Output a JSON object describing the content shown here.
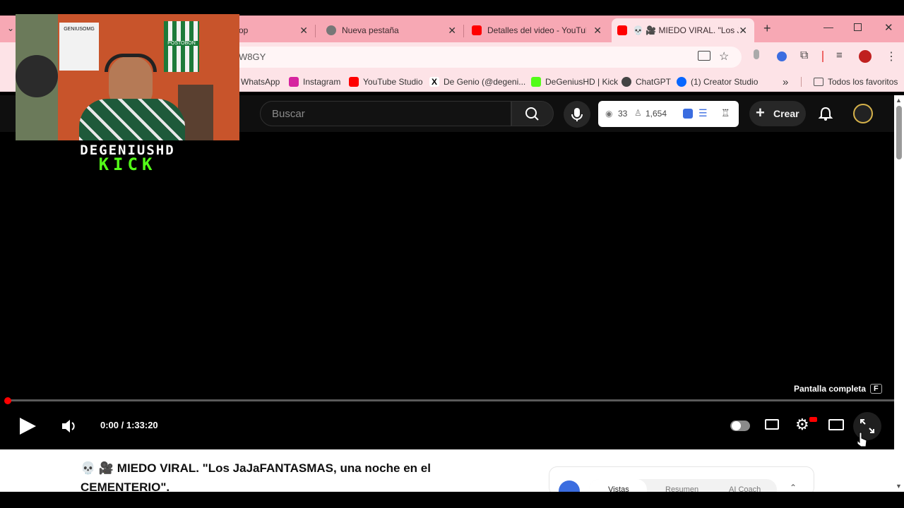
{
  "browser": {
    "tabs": [
      {
        "label": "op",
        "icon": "whatsapp-icon"
      },
      {
        "label": "Nueva pestaña",
        "icon": "chrome-icon"
      },
      {
        "label": "Detalles del video - YouTube",
        "icon": "youtube-icon"
      },
      {
        "label": "💀 🎥 MIEDO VIRAL. \"Los J",
        "icon": "youtube-icon"
      }
    ],
    "new_tab": "+",
    "url": "W8GY",
    "bookmarks": [
      {
        "label": "WhatsApp",
        "icon": "whatsapp-icon",
        "color": "#25d366"
      },
      {
        "label": "Instagram",
        "icon": "instagram-icon",
        "color": "#d6249f"
      },
      {
        "label": "YouTube Studio",
        "icon": "youtube-icon",
        "color": "#ff0000"
      },
      {
        "label": "De Genio (@degeni...",
        "icon": "x-icon",
        "color": "#000000"
      },
      {
        "label": "DeGeniusHD | Kick",
        "icon": "kick-icon",
        "color": "#53fc18"
      },
      {
        "label": "ChatGPT",
        "icon": "chatgpt-icon",
        "color": "#444444"
      },
      {
        "label": "(1) Creator Studio",
        "icon": "meta-icon",
        "color": "#0866ff"
      }
    ],
    "bookmarks_more": "»",
    "all_bookmarks": "Todos los favoritos"
  },
  "youtube": {
    "search_placeholder": "Buscar",
    "stats": {
      "views": "33",
      "subscribers": "1,654"
    },
    "create_label": "Crear"
  },
  "player": {
    "tooltip": "Pantalla completa",
    "tooltip_key": "F",
    "time": "0:00 / 1:33:20",
    "progress_fraction": 0.0
  },
  "video": {
    "title": "💀 🎥 MIEDO VIRAL. \"Los JaJaFANTASMAS, una noche en el CEMENTERIO\"."
  },
  "coach": {
    "tabs": [
      "Vistas",
      "Resumen",
      "AI Coach"
    ]
  },
  "overlay": {
    "name": "DEGENIUSHD",
    "platform": "KICK",
    "shirt_left": "GENIUSOMG",
    "shirt_right": "POSTOBON"
  },
  "colors": {
    "tabbar": "#f7a8b4",
    "accent_red": "#ff0000",
    "kick_green": "#53fc18"
  }
}
